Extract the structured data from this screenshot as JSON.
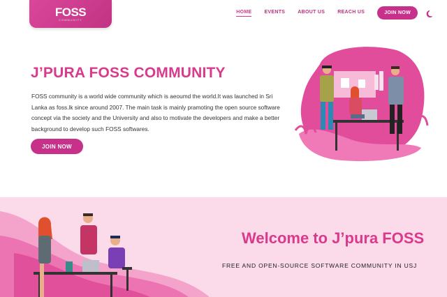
{
  "logo": {
    "text": "FOSS",
    "sub": "COMMUNITY"
  },
  "nav": {
    "items": [
      "HOME",
      "EVENTS",
      "ABOUT US",
      "REACH US"
    ],
    "join_label": "JOIN NOW",
    "theme_icon": "moon-icon"
  },
  "hero": {
    "title": "J’PURA FOSS COMMUNITY",
    "description": "FOSS community is a world wide community which is aeoumd the world.It was launched in Sri Lanka as foss.lk since around 2007. The main task is mainly pramoting the open source software concept via the society and the University and also to motivate the developers and make a better background to develop such FOSS softwares.",
    "join_label": "JOIN NOW"
  },
  "welcome": {
    "title": "Welcome to J’pura FOSS",
    "subtitle": "FREE AND OPEN-SOURCE SOFTWARE COMMUNITY IN USJ"
  },
  "colors": {
    "accent": "#d93a8c",
    "button": "#c8318a",
    "welcome_bg": "#fbdaea"
  }
}
